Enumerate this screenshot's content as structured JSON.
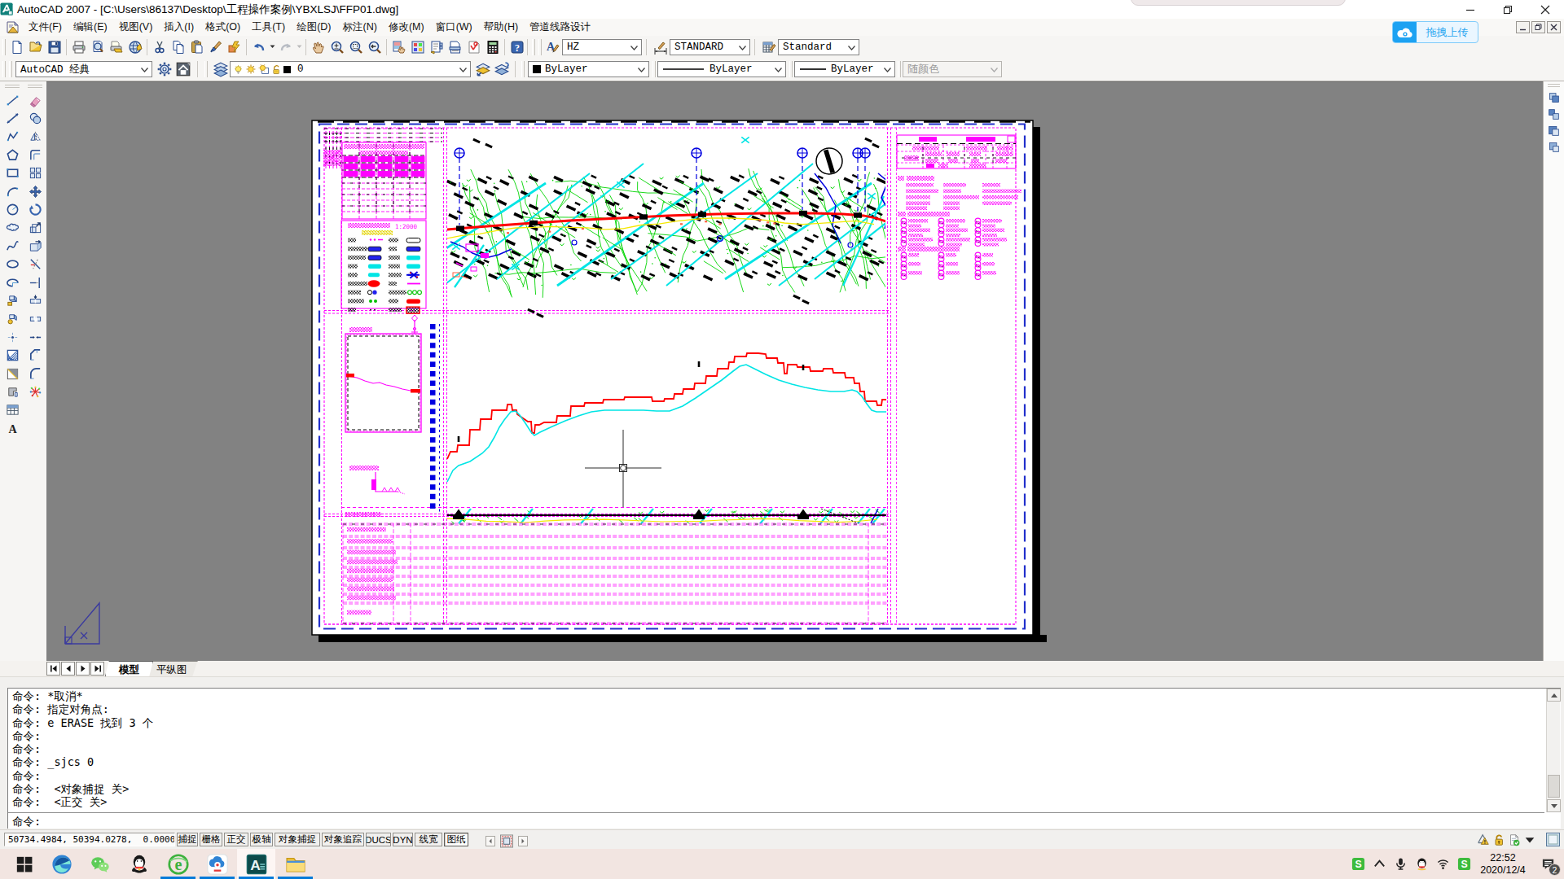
{
  "window": {
    "title": "AutoCAD 2007 - [C:\\Users\\86137\\Desktop\\工程操作案例\\YBXLSJ\\FFP01.dwg]",
    "app_icon": "autocad-logo"
  },
  "overlay": {
    "upload_label": "拖拽上传"
  },
  "menubar": {
    "items": [
      "文件(F)",
      "编辑(E)",
      "视图(V)",
      "插入(I)",
      "格式(O)",
      "工具(T)",
      "绘图(D)",
      "标注(N)",
      "修改(M)",
      "窗口(W)",
      "帮助(H)",
      "管道线路设计"
    ]
  },
  "toolbar_standard": {
    "icons": [
      "new-file",
      "open-file",
      "save",
      "plot",
      "plot-preview",
      "publish",
      "dwf-export",
      "cut",
      "copy-clip",
      "paste",
      "match-properties",
      "hatch-edit",
      "undo",
      "redo",
      "pan",
      "zoom-realtime",
      "zoom-window",
      "zoom-previous",
      "properties",
      "design-center",
      "tool-palettes",
      "sheet-set-manager",
      "markup-set-manager",
      "quick-calc",
      "help"
    ]
  },
  "toolbar_styles": {
    "text_style": "HZ",
    "dim_style": "STANDARD",
    "table_style": "Standard"
  },
  "toolbar_layers": {
    "workspace": "AutoCAD 经典",
    "layer_name": "0",
    "color": "ByLayer",
    "linetype": "ByLayer",
    "lineweight": "ByLayer",
    "plot_style": "随颜色"
  },
  "draw_toolbar": {
    "icons": [
      "line",
      "construction-line",
      "polyline",
      "polygon",
      "rectangle",
      "arc",
      "circle",
      "revision-cloud",
      "spline",
      "ellipse",
      "ellipse-arc",
      "insert-block",
      "make-block",
      "point",
      "hatch",
      "gradient",
      "region",
      "table",
      "multiline-text"
    ]
  },
  "modify_toolbar": {
    "icons": [
      "erase",
      "copy",
      "mirror",
      "offset",
      "array",
      "move",
      "rotate",
      "scale",
      "stretch",
      "trim",
      "extend",
      "break-at-point",
      "break",
      "join",
      "chamfer",
      "fillet",
      "explode"
    ]
  },
  "right_toolbar": {
    "icons": [
      "cascade-windows",
      "tile-windows",
      "tile-vertical",
      "arrange-windows"
    ]
  },
  "layout_tabs": {
    "tabs": [
      "模型",
      "平纵图"
    ],
    "active_tab": "模型"
  },
  "command_window": {
    "history": [
      "命令: *取消*",
      "命令: 指定对角点:",
      "命令: e ERASE 找到 3 个",
      "命令:",
      "命令:",
      "命令: _sjcs 0",
      "命令:",
      "命令:  <对象捕捉 关>",
      "命令:  <正交 关>"
    ],
    "prompt": "命令:"
  },
  "status_bar": {
    "coordinates": "50734.4984, 50394.0278,  0.0000",
    "toggles": [
      "捕捉",
      "栅格",
      "正交",
      "极轴",
      "对象捕捉",
      "对象追踪",
      "DUCS",
      "DYN",
      "线宽",
      "图纸"
    ],
    "pressed_toggle": "图纸",
    "right_icons": [
      "annotation-warning",
      "unlock",
      "trusted-dwg",
      "caret-down"
    ],
    "clean_screen_icon": "clean-screen"
  },
  "taskbar": {
    "apps": [
      "start",
      "edge",
      "wechat",
      "qq",
      "internet-explorer",
      "baidu-netdisk",
      "autocad",
      "file-explorer"
    ],
    "running_apps": [
      "internet-explorer",
      "baidu-netdisk",
      "autocad",
      "file-explorer"
    ],
    "active_app": "autocad",
    "tray_icons": [
      "stream-green",
      "chevron-up",
      "microphone",
      "qq-tray",
      "wifi",
      "stream-green-2"
    ],
    "clock_time": "22:52",
    "clock_date": "2020/12/4",
    "notification_badge": "2"
  },
  "drawing": {
    "legend_scale_label": "1:2000",
    "colors": {
      "frame": "#FF00FF",
      "contour_green": "#00D400",
      "water_cyan": "#00E5E5",
      "alignment_red": "#FF0000",
      "design_yellow": "#F5E800",
      "marker_blue": "#0000E0",
      "ground_red": "#FF0000",
      "pipeline_cyan": "#00E5E5",
      "paper": "#FFFFFF",
      "canvas": "#828282"
    }
  }
}
